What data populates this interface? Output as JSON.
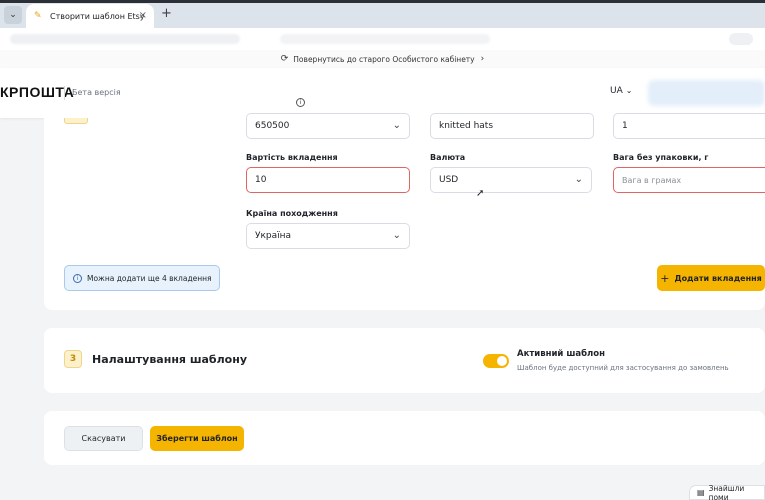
{
  "browser": {
    "tab_title": "Створити шаблон Etsy",
    "tab_close": "×",
    "new_tab": "+",
    "tab_menu": "⌄"
  },
  "notice": {
    "text": "Повернутись до старого Особистого кабінету",
    "icon": "refresh-icon",
    "chevron": "›"
  },
  "header": {
    "logo": "КРПОШТА",
    "beta": "Бета версія",
    "lang": "UA",
    "lang_chevron": "⌄"
  },
  "attachment": {
    "hs_code_value": "650500",
    "description_value": "knitted hats",
    "quantity_value": "1",
    "value_label": "Вартість вкладення",
    "value_value": "10",
    "currency_label": "Валюта",
    "currency_value": "USD",
    "weight_label": "Вага без упаковки, г",
    "weight_placeholder": "Вага в грамах",
    "origin_label": "Країна походження",
    "origin_value": "Україна",
    "hint": "Можна додати ще 4 вкладення",
    "add_button": "Додати вкладення"
  },
  "settings": {
    "step": "3",
    "title": "Налаштування шаблону",
    "active_title": "Активний шаблон",
    "active_desc": "Шаблон буде доступний для застосування до замовлень",
    "active_on": true
  },
  "actions": {
    "cancel": "Скасувати",
    "save": "Зберегти шаблон"
  },
  "feedback": {
    "label": "Знайшли поми"
  },
  "colors": {
    "accent": "#f5b400",
    "error": "#e06666",
    "info_bg": "#e8f2fc"
  }
}
